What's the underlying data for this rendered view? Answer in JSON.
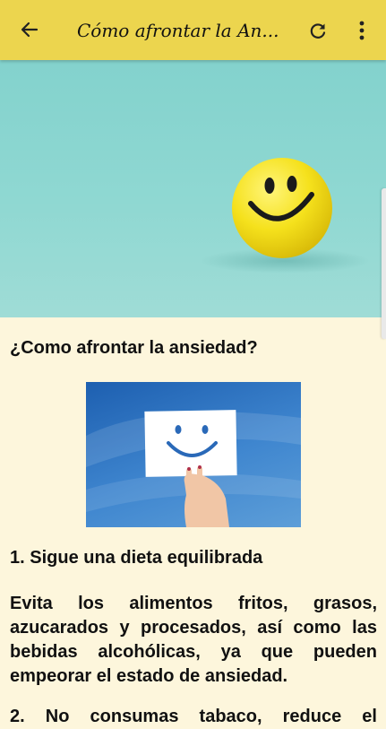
{
  "appbar": {
    "title": "Cómo afrontar la An...",
    "back_icon": "arrow-left-icon",
    "refresh_icon": "refresh-icon",
    "more_icon": "more-vertical-icon",
    "background": "#ecd54e"
  },
  "article": {
    "heading": "¿Como afrontar la ansiedad?",
    "section1_title": "1. Sigue una dieta equilibrada",
    "section1_text": "Evita los alimentos fritos, grasos, azucarados y procesados, así como las bebidas alcohólicas, ya que pueden empeorar el estado de ansiedad.",
    "section2_title": "2. No consumas tabaco, reduce el"
  },
  "colors": {
    "page_background": "#fdf6dc",
    "hero_background": "#8fd8d2",
    "smiley_yellow": "#f5e11c"
  }
}
